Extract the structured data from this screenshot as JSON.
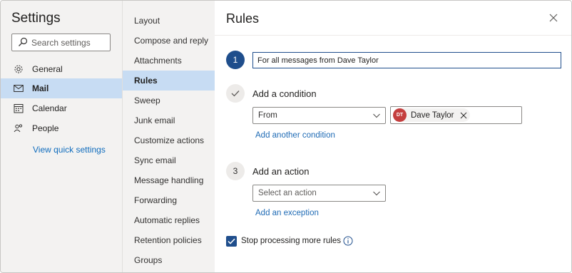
{
  "left": {
    "title": "Settings",
    "search_placeholder": "Search settings",
    "nav": [
      {
        "label": "General",
        "icon": "gear-icon"
      },
      {
        "label": "Mail",
        "icon": "mail-icon"
      },
      {
        "label": "Calendar",
        "icon": "calendar-icon"
      },
      {
        "label": "People",
        "icon": "people-icon"
      }
    ],
    "quick_settings": "View quick settings"
  },
  "mid": {
    "items": [
      "Layout",
      "Compose and reply",
      "Attachments",
      "Rules",
      "Sweep",
      "Junk email",
      "Customize actions",
      "Sync email",
      "Message handling",
      "Forwarding",
      "Automatic replies",
      "Retention policies",
      "Groups"
    ],
    "active": "Rules"
  },
  "rules": {
    "title": "Rules",
    "step1_number": "1",
    "rule_name_value": "For all messages from Dave Taylor",
    "condition_label": "Add a condition",
    "condition_dropdown": "From",
    "person_initials": "DT",
    "person_name": "Dave Taylor",
    "add_condition_link": "Add another condition",
    "step3_number": "3",
    "action_label": "Add an action",
    "action_placeholder": "Select an action",
    "add_exception_link": "Add an exception",
    "stop_processing_label": "Stop processing more rules",
    "stop_processing_checked": true
  },
  "colors": {
    "accent": "#1f4e8c",
    "active_nav": "#c7dcf3",
    "pane_bg": "#f3f2f1",
    "link": "#1f6bb5",
    "avatar": "#c43e3e"
  }
}
